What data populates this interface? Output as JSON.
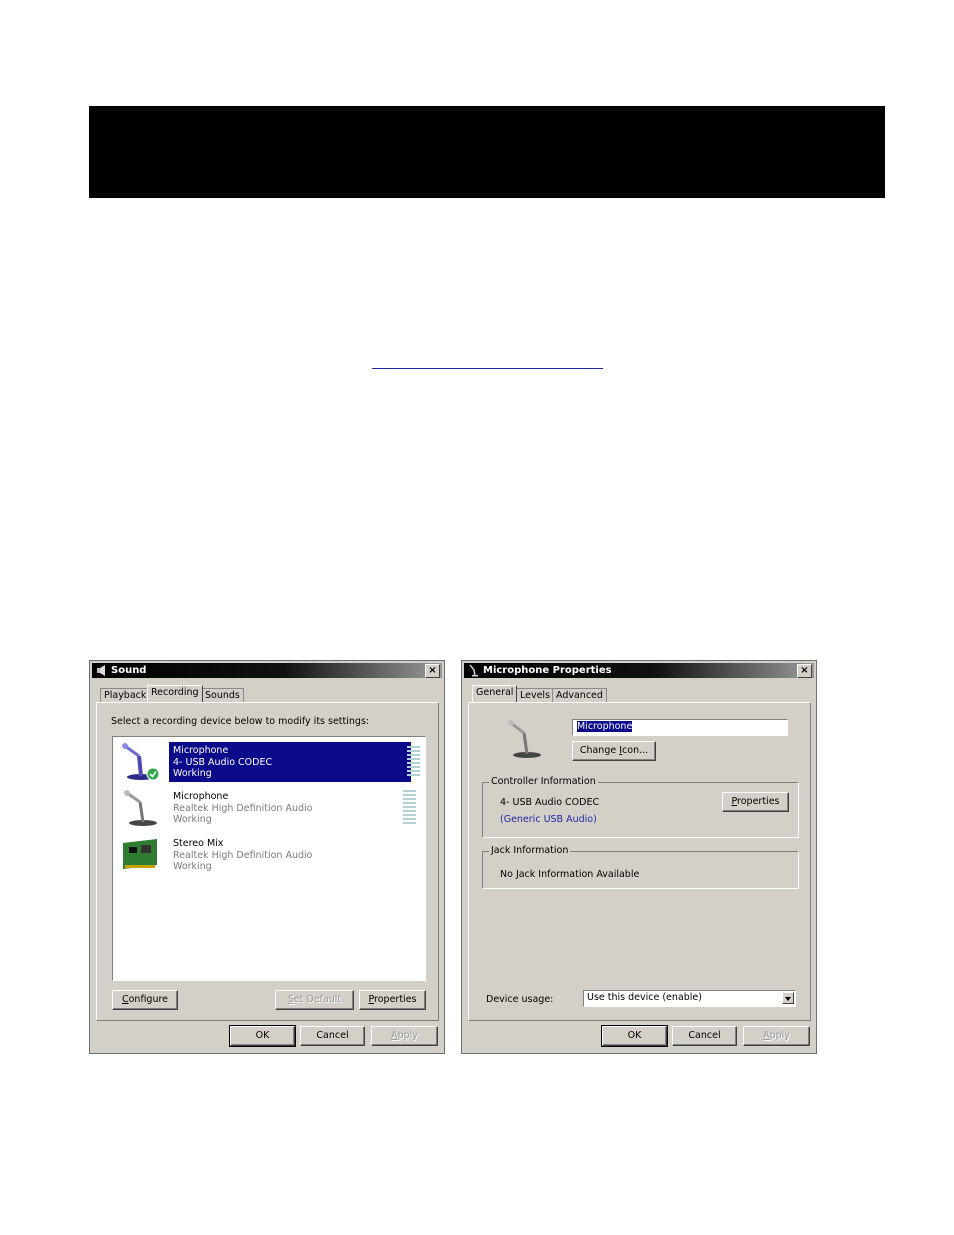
{
  "sound_dialog": {
    "title": "Sound",
    "close": "×",
    "tabs": [
      "Playback",
      "Recording",
      "Sounds"
    ],
    "instruction": "Select a recording device below to modify its settings:",
    "devices": [
      {
        "name": "Microphone",
        "line2": "4- USB Audio CODEC",
        "status": "Working",
        "icon": "usb-microphone-icon"
      },
      {
        "name": "Microphone",
        "line2": "Realtek High Definition Audio",
        "status": "Working",
        "icon": "microphone-icon"
      },
      {
        "name": "Stereo Mix",
        "line2": "Realtek High Definition Audio",
        "status": "Working",
        "icon": "sound-card-icon"
      }
    ],
    "configure_hot": "C",
    "configure_rest": "onfigure",
    "set_default_hot": "S",
    "set_default_rest": "et Default",
    "properties_hot": "P",
    "properties_rest": "roperties",
    "ok": "OK",
    "cancel": "Cancel",
    "apply_hot": "A",
    "apply_rest": "pply"
  },
  "mic_dialog": {
    "title": "Microphone Properties",
    "close": "×",
    "tabs": [
      "General",
      "Levels",
      "Advanced"
    ],
    "name_value": "Microphone",
    "change_icon_pre": "Change ",
    "change_icon_hot": "I",
    "change_icon_post": "con...",
    "controller_group": "Controller Information",
    "controller_name": "4- USB Audio CODEC",
    "controller_driver": "(Generic USB Audio)",
    "properties_hot": "P",
    "properties_rest": "roperties",
    "jack_group": "Jack Information",
    "jack_text": "No Jack Information Available",
    "device_usage_label": "Device usage:",
    "device_usage_value": "Use this device (enable)",
    "ok": "OK",
    "cancel": "Cancel",
    "apply_hot": "A",
    "apply_rest": "pply"
  },
  "colors": {
    "selection": "#0a0a8a",
    "dialog_face": "#d4d0c8",
    "link": "#1f2aa6"
  }
}
